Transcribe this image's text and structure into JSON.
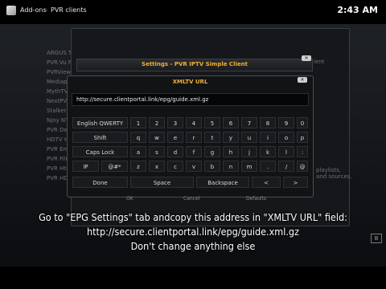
{
  "topbar": {
    "app": "Add-ons",
    "section": "PVR clients",
    "time": "2:43 AM"
  },
  "background": {
    "list": [
      "ARGUS TV cl",
      "PVR.Vu PVR C",
      "PVRViewer C",
      "Mediaportal",
      "MythTV PVR",
      "NextPVR PVR",
      "Stalker Mid",
      "Njoy NT PVR",
      "PVR Demo Cl",
      "HDTV Home",
      "PVR Emby Cl",
      "PVR Filmon",
      "PVR Hts",
      "PVR HDHomeR"
    ],
    "side_text": [
      "ient"
    ],
    "side_lower": [
      "playlists,",
      "and sources."
    ]
  },
  "settings_title": "Settings - PVR IPTV Simple Client",
  "dialog": {
    "title": "XMLTV URL",
    "url_value": "http://secure.clientportal.link/epg/guide.xml.gz",
    "keys": {
      "layout": "English QWERTY",
      "shift": "Shift",
      "caps": "Caps Lock",
      "ip": "IP",
      "symbols": "@#*",
      "row1": [
        "1",
        "2",
        "3",
        "4",
        "5",
        "6",
        "7",
        "8",
        "9",
        "0"
      ],
      "row2": [
        "q",
        "w",
        "e",
        "r",
        "t",
        "y",
        "u",
        "i",
        "o",
        "p"
      ],
      "row3": [
        "a",
        "s",
        "d",
        "f",
        "g",
        "h",
        "j",
        "k",
        "l",
        ":"
      ],
      "row4": [
        "z",
        "x",
        "c",
        "v",
        "b",
        "n",
        "m",
        ".",
        "/",
        "@"
      ],
      "done": "Done",
      "space": "Space",
      "backspace": "Backspace",
      "left": "<",
      "right": ">"
    },
    "under_buttons": [
      "OK",
      "Cancel",
      "Defaults"
    ]
  },
  "caption": {
    "line1": "Go to \"EPG Settings\" tab andcopy this address in \"XMLTV URL\" field:",
    "line2": "http://secure.clientportal.link/epg/guide.xml.gz",
    "line3": "Don't change anything else"
  },
  "colors": {
    "accent": "#f0b030"
  }
}
